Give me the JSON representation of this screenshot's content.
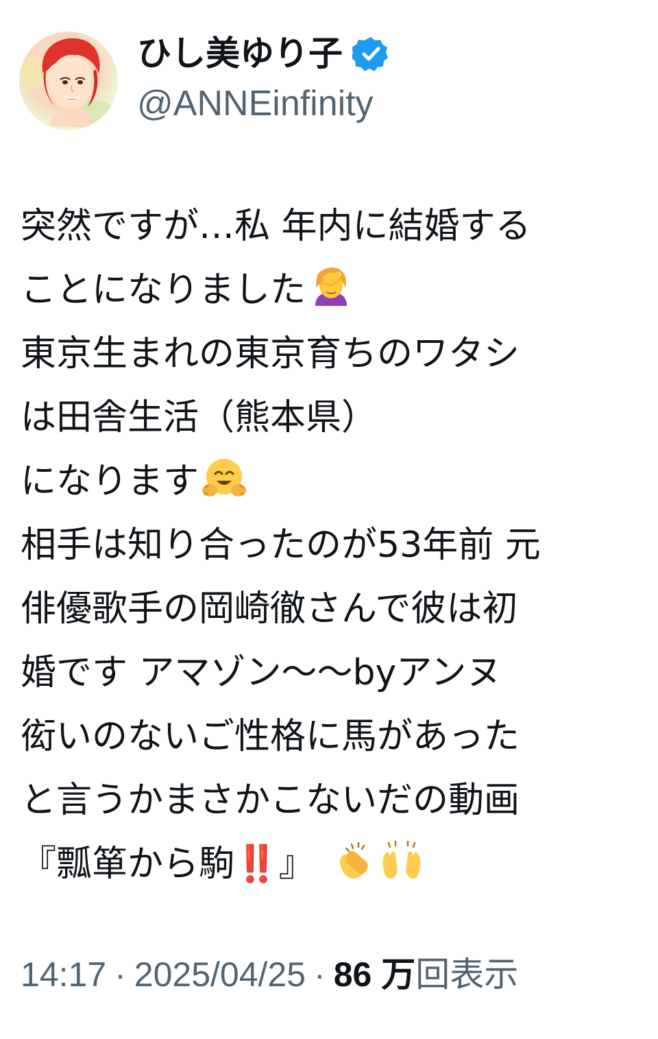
{
  "profile": {
    "display_name": "ひし美ゆり子",
    "handle": "@ANNEinfinity",
    "verified_icon": "verified-badge-icon",
    "avatar_icon": "avatar-portrait-illustration"
  },
  "tweet": {
    "lines": {
      "l1": "突然ですが…私 年内に結婚する",
      "l2": "ことになりました",
      "l3": "東京生まれの東京育ちのワタシ",
      "l4": "は田舎生活（熊本県）",
      "l5": "になります",
      "l6": "相手は知り合ったのが53年前 元",
      "l7": "俳優歌手の岡崎徹さんで彼は初",
      "l8": "婚です アマゾン〜〜byアンヌ",
      "l9": "衒いのないご性格に馬があった",
      "l10": "と言うかまさかこないだの動画",
      "l11a": "『瓢箪から駒",
      "l11b": "』"
    },
    "emojis": {
      "facepalm": "woman-facepalming-emoji",
      "hug": "hugging-face-emoji",
      "exclamation": "‼️",
      "clap": "clapping-hands-emoji",
      "raised_hands": "raising-hands-emoji"
    }
  },
  "meta": {
    "time": "14:17",
    "separator": "·",
    "date": "2025/04/25",
    "views_count": "86 万",
    "views_label": "回表示"
  },
  "colors": {
    "text": "#0f1419",
    "secondary": "#536471",
    "verified": "#1d9bf0",
    "excl": "#e0245e"
  }
}
